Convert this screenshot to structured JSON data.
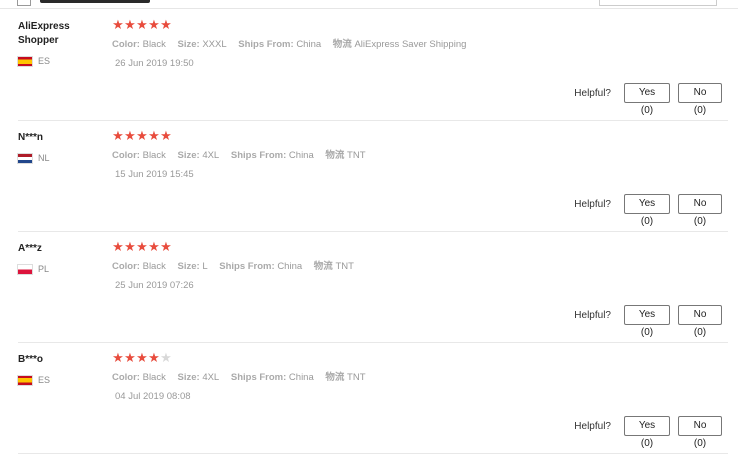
{
  "reviews": [
    {
      "user_line1": "AliExpress",
      "user_line2": "Shopper",
      "country": "ES",
      "flag": "es",
      "rating": 5,
      "color_label": "Color:",
      "color_value": "Black",
      "size_label": "Size:",
      "size_value": "XXXL",
      "ships_label": "Ships From:",
      "ships_value": "China",
      "logistics_label": "物流",
      "logistics_value": "AliExpress Saver Shipping",
      "date": "26 Jun 2019 19:50",
      "helpful_label": "Helpful?",
      "yes_label": "Yes (0)",
      "no_label": "No (0)"
    },
    {
      "user_line1": "N***n",
      "user_line2": "",
      "country": "NL",
      "flag": "nl",
      "rating": 5,
      "color_label": "Color:",
      "color_value": "Black",
      "size_label": "Size:",
      "size_value": "4XL",
      "ships_label": "Ships From:",
      "ships_value": "China",
      "logistics_label": "物流",
      "logistics_value": "TNT",
      "date": "15 Jun 2019 15:45",
      "helpful_label": "Helpful?",
      "yes_label": "Yes (0)",
      "no_label": "No (0)"
    },
    {
      "user_line1": "A***z",
      "user_line2": "",
      "country": "PL",
      "flag": "pl",
      "rating": 5,
      "color_label": "Color:",
      "color_value": "Black",
      "size_label": "Size:",
      "size_value": "L",
      "ships_label": "Ships From:",
      "ships_value": "China",
      "logistics_label": "物流",
      "logistics_value": "TNT",
      "date": "25 Jun 2019 07:26",
      "helpful_label": "Helpful?",
      "yes_label": "Yes (0)",
      "no_label": "No (0)"
    },
    {
      "user_line1": "B***o",
      "user_line2": "",
      "country": "ES",
      "flag": "es",
      "rating": 4,
      "color_label": "Color:",
      "color_value": "Black",
      "size_label": "Size:",
      "size_value": "4XL",
      "ships_label": "Ships From:",
      "ships_value": "China",
      "logistics_label": "物流",
      "logistics_value": "TNT",
      "date": "04 Jul 2019 08:08",
      "helpful_label": "Helpful?",
      "yes_label": "Yes (0)",
      "no_label": "No (0)"
    }
  ],
  "colors": {
    "star_filled": "#e84c3d",
    "star_empty": "#d8d8d8"
  },
  "icons": {
    "star": "star-icon",
    "flag": "flag-icon"
  }
}
